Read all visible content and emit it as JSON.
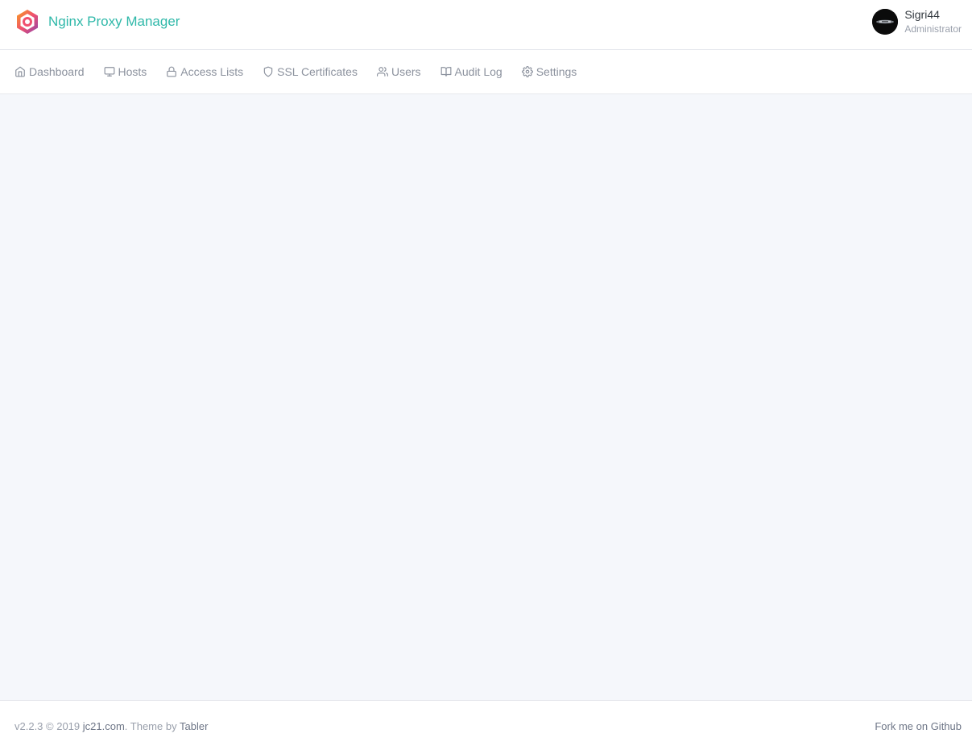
{
  "app": {
    "brand_name": "Nginx Proxy Manager",
    "brand_color": "#2fb8a9",
    "logo_icon": "hexagon-logo-icon"
  },
  "user": {
    "name": "Sigri44",
    "role": "Administrator",
    "avatar_icon": "avatar-image"
  },
  "nav": {
    "items": [
      {
        "label": "Dashboard",
        "icon": "home-icon"
      },
      {
        "label": "Hosts",
        "icon": "monitor-icon"
      },
      {
        "label": "Access Lists",
        "icon": "lock-icon"
      },
      {
        "label": "SSL Certificates",
        "icon": "shield-icon"
      },
      {
        "label": "Users",
        "icon": "users-icon"
      },
      {
        "label": "Audit Log",
        "icon": "book-open-icon"
      },
      {
        "label": "Settings",
        "icon": "settings-icon"
      }
    ]
  },
  "footer": {
    "version": "v2.2.3 © 2019",
    "company_link": "jc21.com",
    "theme_text": ". Theme by",
    "theme_link": "Tabler",
    "github_link": "Fork me on Github"
  }
}
